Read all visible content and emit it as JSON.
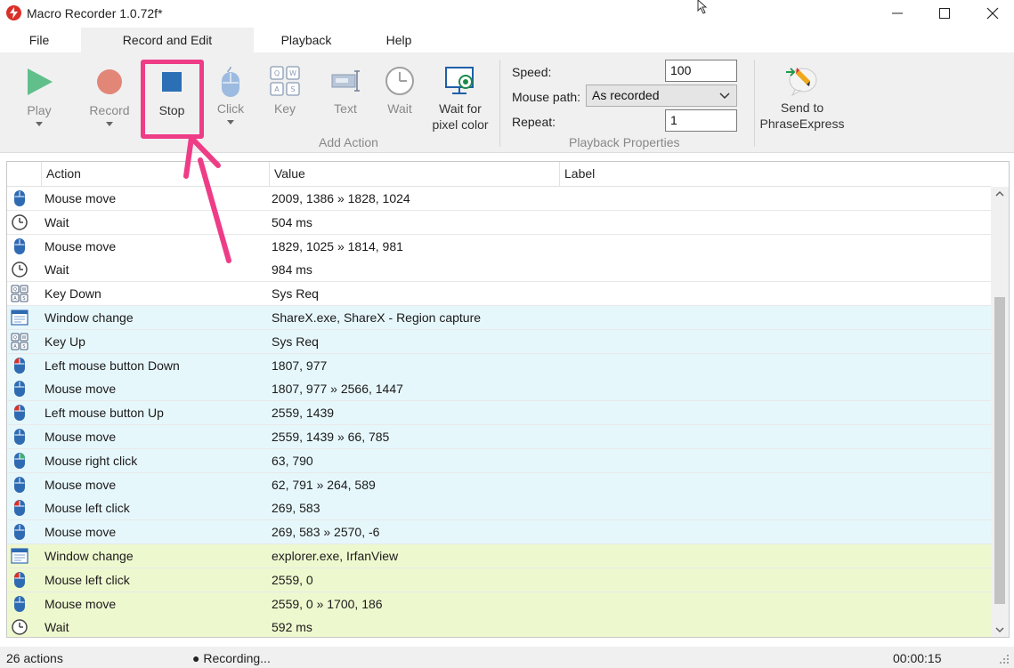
{
  "window": {
    "title": "Macro Recorder 1.0.72f*"
  },
  "menu": {
    "tabs": [
      "File",
      "Record and Edit",
      "Playback",
      "Help"
    ]
  },
  "ribbon": {
    "buttons": {
      "play": "Play",
      "record": "Record",
      "stop": "Stop",
      "click": "Click",
      "key": "Key",
      "text": "Text",
      "wait": "Wait",
      "wait_pixel_line1": "Wait for",
      "wait_pixel_line2": "pixel color",
      "send_line1": "Send to",
      "send_line2": "PhraseExpress"
    },
    "groups": {
      "add_action": "Add Action",
      "playback_properties": "Playback Properties"
    },
    "playback_properties": {
      "speed_label": "Speed:",
      "speed_value": "100",
      "mouse_path_label": "Mouse path:",
      "mouse_path_value": "As recorded",
      "repeat_label": "Repeat:",
      "repeat_value": "1"
    },
    "colors": {
      "play": "#3cb371",
      "record": "#e07a6a",
      "stop": "#2b6fb5",
      "highlight": "#ee3d86"
    }
  },
  "table": {
    "headers": {
      "action": "Action",
      "value": "Value",
      "label": "Label"
    },
    "rows": [
      {
        "icon": "mouse-icon",
        "action": "Mouse move",
        "value": "2009, 1386 » 1828, 1024",
        "label": "",
        "color": "white"
      },
      {
        "icon": "clock-icon",
        "action": "Wait",
        "value": "504 ms",
        "label": "",
        "color": "white"
      },
      {
        "icon": "mouse-icon",
        "action": "Mouse move",
        "value": "1829, 1025 » 1814, 981",
        "label": "",
        "color": "white"
      },
      {
        "icon": "clock-icon",
        "action": "Wait",
        "value": "984 ms",
        "label": "",
        "color": "white"
      },
      {
        "icon": "keys-icon",
        "action": "Key Down",
        "value": "Sys Req",
        "label": "",
        "color": "white"
      },
      {
        "icon": "window-icon",
        "action": "Window change",
        "value": "ShareX.exe, ShareX - Region capture",
        "label": "",
        "color": "blue"
      },
      {
        "icon": "keys-icon",
        "action": "Key Up",
        "value": "Sys Req",
        "label": "",
        "color": "blue"
      },
      {
        "icon": "mouse-left-icon",
        "action": "Left mouse button Down",
        "value": "1807, 977",
        "label": "",
        "color": "blue"
      },
      {
        "icon": "mouse-icon",
        "action": "Mouse move",
        "value": "1807, 977 » 2566, 1447",
        "label": "",
        "color": "blue"
      },
      {
        "icon": "mouse-left-icon",
        "action": "Left mouse button Up",
        "value": "2559, 1439",
        "label": "",
        "color": "blue"
      },
      {
        "icon": "mouse-icon",
        "action": "Mouse move",
        "value": "2559, 1439 » 66, 785",
        "label": "",
        "color": "blue"
      },
      {
        "icon": "mouse-right-icon",
        "action": "Mouse right click",
        "value": "63, 790",
        "label": "",
        "color": "blue"
      },
      {
        "icon": "mouse-icon",
        "action": "Mouse move",
        "value": "62, 791 » 264, 589",
        "label": "",
        "color": "blue"
      },
      {
        "icon": "mouse-left-icon",
        "action": "Mouse left click",
        "value": "269, 583",
        "label": "",
        "color": "blue"
      },
      {
        "icon": "mouse-icon",
        "action": "Mouse move",
        "value": "269, 583 » 2570, -6",
        "label": "",
        "color": "blue"
      },
      {
        "icon": "window-icon",
        "action": "Window change",
        "value": "explorer.exe, IrfanView",
        "label": "",
        "color": "green"
      },
      {
        "icon": "mouse-left-icon",
        "action": "Mouse left click",
        "value": "2559, 0",
        "label": "",
        "color": "green"
      },
      {
        "icon": "mouse-icon",
        "action": "Mouse move",
        "value": "2559, 0 » 1700, 186",
        "label": "",
        "color": "green"
      },
      {
        "icon": "clock-icon",
        "action": "Wait",
        "value": "592 ms",
        "label": "",
        "color": "green"
      }
    ]
  },
  "status": {
    "actions": "26 actions",
    "recording": "● Recording...",
    "timer": "00:00:15"
  }
}
